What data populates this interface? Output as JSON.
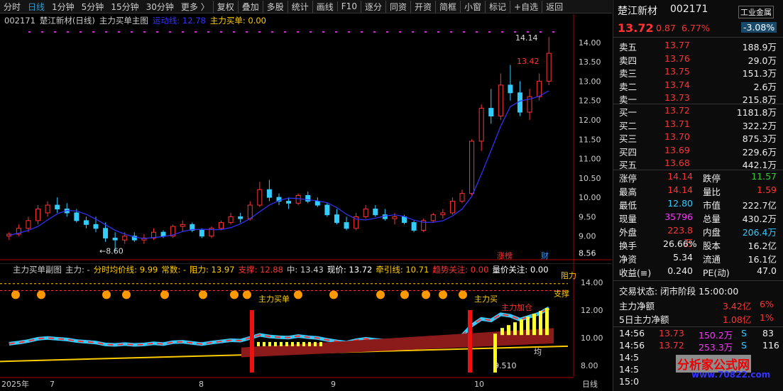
{
  "toolbar": {
    "tabs": [
      "分时",
      "日线",
      "1分钟",
      "5分钟",
      "15分钟",
      "30分钟",
      "更多 〉"
    ],
    "active": "日线",
    "tools": [
      "复权",
      "叠加",
      "多股",
      "统计",
      "画线",
      "F10",
      "逐分",
      "同资",
      "开资",
      "简框",
      "小窗",
      "标记",
      "+自选",
      "返回"
    ]
  },
  "main_info": {
    "code": "002171",
    "name": "楚江新材(日线)",
    "formula": "主力买单主图",
    "line1_label": "运动线: 12.78",
    "line2_label": "主力买单: 0.00"
  },
  "sub_info": {
    "title": "主力买单副图",
    "items": [
      "主力: -",
      "分时均价线: 9.99",
      "常数: -",
      "阻力: 13.97",
      "支撑: 12.88",
      "中: 13.43",
      "现价: 13.72",
      "牵引线: 10.71",
      "趋势关注: 0.00",
      "量价关注: 0.00"
    ]
  },
  "chart_data": {
    "type": "candlestick",
    "ylim": [
      8.5,
      14.4
    ],
    "y_ticks": [
      "14.00",
      "13.50",
      "13.00",
      "12.50",
      "12.00",
      "11.50",
      "11.00",
      "10.50",
      "10.00",
      "9.50",
      "9.00",
      "8.56"
    ],
    "sub_y_ticks": [
      "14.00",
      "12.00",
      "10.00",
      "8.00"
    ],
    "x_labels": [
      "2025年",
      "7",
      "8",
      "9",
      "10"
    ],
    "annotations": {
      "high": "14.14",
      "high2": "13.42",
      "low": "8.60",
      "mark1": "涨榜",
      "mark2": "财",
      "sub_labels": [
        "主力买单",
        "主力买",
        "主力加仓",
        "阻力",
        "支撑",
        "均",
        "9.510"
      ]
    },
    "ohlc": [
      [
        9.0,
        9.1,
        8.9,
        9.05
      ],
      [
        9.05,
        9.3,
        9.0,
        9.2
      ],
      [
        9.2,
        9.5,
        9.1,
        9.4
      ],
      [
        9.4,
        9.8,
        9.3,
        9.7
      ],
      [
        9.6,
        9.9,
        9.5,
        9.8
      ],
      [
        9.8,
        10.0,
        9.6,
        9.7
      ],
      [
        9.7,
        9.85,
        9.5,
        9.6
      ],
      [
        9.6,
        9.7,
        9.35,
        9.4
      ],
      [
        9.4,
        9.5,
        9.2,
        9.3
      ],
      [
        9.3,
        9.5,
        9.1,
        9.2
      ],
      [
        9.2,
        9.35,
        8.85,
        8.95
      ],
      [
        8.95,
        9.1,
        8.6,
        8.9
      ],
      [
        8.9,
        9.1,
        8.8,
        9.0
      ],
      [
        9.0,
        9.1,
        8.85,
        8.9
      ],
      [
        8.9,
        9.05,
        8.8,
        8.95
      ],
      [
        8.95,
        9.2,
        8.9,
        9.1
      ],
      [
        9.1,
        9.15,
        8.95,
        9.0
      ],
      [
        9.0,
        9.3,
        8.95,
        9.25
      ],
      [
        9.25,
        9.4,
        9.1,
        9.3
      ],
      [
        9.3,
        9.35,
        9.1,
        9.15
      ],
      [
        9.15,
        9.2,
        8.95,
        9.0
      ],
      [
        9.0,
        9.25,
        8.95,
        9.2
      ],
      [
        9.2,
        9.4,
        9.15,
        9.35
      ],
      [
        9.35,
        9.6,
        9.3,
        9.5
      ],
      [
        9.5,
        9.6,
        9.35,
        9.45
      ],
      [
        9.45,
        9.9,
        9.4,
        9.8
      ],
      [
        9.8,
        10.4,
        9.75,
        10.2
      ],
      [
        10.2,
        10.45,
        9.9,
        10.0
      ],
      [
        10.0,
        10.1,
        9.8,
        9.9
      ],
      [
        9.9,
        10.0,
        9.7,
        9.85
      ],
      [
        9.85,
        10.1,
        9.8,
        10.05
      ],
      [
        10.05,
        10.15,
        9.85,
        9.9
      ],
      [
        9.9,
        10.0,
        9.75,
        9.8
      ],
      [
        9.8,
        9.85,
        9.5,
        9.55
      ],
      [
        9.55,
        9.7,
        9.3,
        9.35
      ],
      [
        9.35,
        9.5,
        9.15,
        9.2
      ],
      [
        9.2,
        9.6,
        9.15,
        9.5
      ],
      [
        9.5,
        9.8,
        9.45,
        9.7
      ],
      [
        9.7,
        9.8,
        9.5,
        9.55
      ],
      [
        9.55,
        9.7,
        9.4,
        9.45
      ],
      [
        9.45,
        9.6,
        9.3,
        9.5
      ],
      [
        9.5,
        9.55,
        9.3,
        9.35
      ],
      [
        9.35,
        9.4,
        9.1,
        9.15
      ],
      [
        9.15,
        9.45,
        9.1,
        9.4
      ],
      [
        9.4,
        9.6,
        9.35,
        9.55
      ],
      [
        9.55,
        9.7,
        9.45,
        9.6
      ],
      [
        9.6,
        10.0,
        9.55,
        9.9
      ],
      [
        9.9,
        10.2,
        9.85,
        10.1
      ],
      [
        10.1,
        11.5,
        10.05,
        11.45
      ],
      [
        11.45,
        12.4,
        11.2,
        12.3
      ],
      [
        12.3,
        12.8,
        11.9,
        12.1
      ],
      [
        12.1,
        13.2,
        12.0,
        12.9
      ],
      [
        12.9,
        13.42,
        12.5,
        12.7
      ],
      [
        12.7,
        13.0,
        12.1,
        12.2
      ],
      [
        12.2,
        12.8,
        12.0,
        12.6
      ],
      [
        12.6,
        13.2,
        12.5,
        13.0
      ],
      [
        13.0,
        14.14,
        12.9,
        13.72
      ]
    ]
  },
  "side": {
    "name": "楚江新材",
    "code": "002171",
    "tag": "工业金属",
    "tag_pct": "-3.08%",
    "price": "13.72",
    "chg": "0.87",
    "pct": "6.77%",
    "asks": [
      [
        "卖五",
        "13.77",
        "188.9万"
      ],
      [
        "卖四",
        "13.76",
        "29.0万"
      ],
      [
        "卖三",
        "13.75",
        "151.3万"
      ],
      [
        "卖二",
        "13.74",
        "2.6万"
      ],
      [
        "卖一",
        "13.73",
        "215.8万"
      ]
    ],
    "bids": [
      [
        "买一",
        "13.72",
        "1181.8万"
      ],
      [
        "买二",
        "13.71",
        "322.2万"
      ],
      [
        "买三",
        "13.70",
        "875.3万"
      ],
      [
        "买四",
        "13.69",
        "229.6万"
      ],
      [
        "买五",
        "13.68",
        "442.1万"
      ]
    ],
    "stats": [
      [
        "涨停",
        "14.14",
        "跌停",
        "11.57"
      ],
      [
        "最高",
        "14.14",
        "量比",
        "1.59"
      ],
      [
        "最低",
        "12.80",
        "市值",
        "222.7亿"
      ],
      [
        "现量",
        "35796",
        "总量",
        "430.2万"
      ],
      [
        "外盘",
        "223.8万",
        "内盘",
        "206.4万"
      ],
      [
        "换手",
        "26.66%",
        "股本",
        "16.2亿"
      ],
      [
        "净资",
        "5.34",
        "流通",
        "16.1亿"
      ],
      [
        "收益(≡)",
        "0.240",
        "PE(动)",
        "47.0"
      ]
    ],
    "status": "交易状态: 闭市阶段 15:00:00",
    "flow": [
      [
        "主力净额",
        "3.42亿",
        "6%"
      ],
      [
        "5日主力净额",
        "1.08亿",
        "1%"
      ]
    ],
    "ticks": [
      [
        "14:56",
        "13.73",
        "150.2万",
        "S",
        "83"
      ],
      [
        "14:56",
        "13.72",
        "253.3万",
        "S",
        "116"
      ],
      [
        "14:5",
        ""
      ],
      [
        "14:5",
        ""
      ],
      [
        "15:0",
        ""
      ]
    ],
    "watermark": "分析家公式网",
    "watermark_url": "www.70822.com"
  }
}
